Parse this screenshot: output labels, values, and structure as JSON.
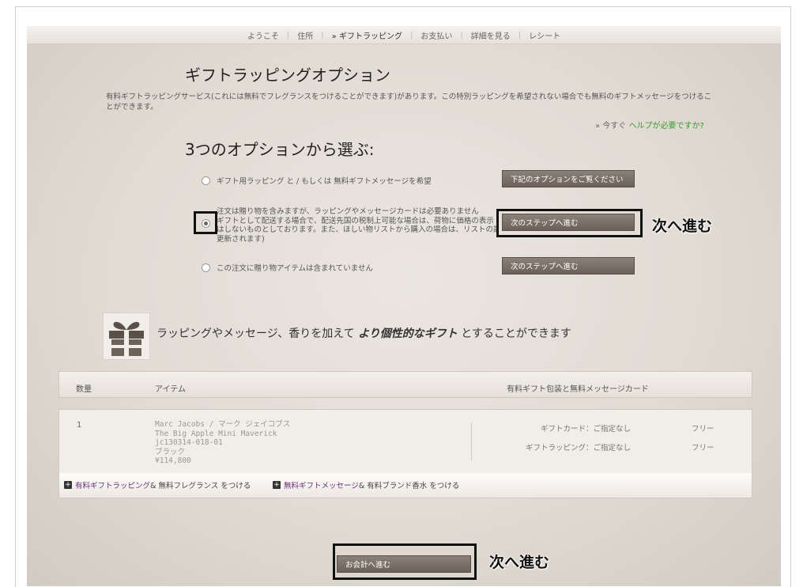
{
  "nav": {
    "items": [
      "ようこそ",
      "住所",
      "» ギフトラッピング",
      "お支払い",
      "詳細を見る",
      "レシート"
    ],
    "active_index": 2
  },
  "page": {
    "title": "ギフトラッピングオプション",
    "intro": "有料ギフトラッピングサービス(これには無料でフレグランスをつけることができます)があります。この特別ラッピングを希望されない場合でも無料のギフトメッセージをつけることができます。",
    "help_prefix": "» 今すぐ",
    "help_link": "ヘルプが必要ですか?",
    "choose_title": "3つのオプションから選ぶ:"
  },
  "options": [
    {
      "text": "ギフト用ラッピング と / もしくは 無料ギフトメッセージを希望",
      "button": "下記のオプションをご覧ください",
      "checked": false
    },
    {
      "text_lines": [
        "注文は贈り物を含みますが、ラッピングやメッセージカードは必要ありません",
        "ギフトとして配送する場合で、配送先国の税制上可能な場合は、荷物に価格の表示",
        "はしないものとしております。また、ほしい物リストから購入の場合は、リストの記録が",
        "更新されます)"
      ],
      "button": "次のステップへ進む",
      "checked": true
    },
    {
      "text": "この注文に贈り物アイテムは含まれていません",
      "button": "次のステップへ進む",
      "checked": false
    }
  ],
  "annotations": {
    "next1": "次へ進む",
    "next2": "次へ進む"
  },
  "tagline": {
    "before": "ラッピングやメッセージ、香りを加えて ",
    "emphasis": "より個性的なギフト",
    "after": " とすることができます"
  },
  "table": {
    "headers": [
      "数量",
      "アイテム",
      "有料ギフト包装と無料メッセージカード"
    ]
  },
  "item": {
    "qty": "1",
    "desc_lines": [
      "Marc Jacobs / マーク ジェイコブス",
      "The Big Apple Mini Maverick",
      "jc130314-018-01",
      "ブラック",
      "¥114,800"
    ],
    "gift_card_label": "ギフトカード：ご指定なし",
    "gift_card_value": "フリー",
    "gift_wrap_label": "ギフトラッピング：ご指定なし",
    "gift_wrap_value": "フリー",
    "extra1_link": "有料ギフトラッピング",
    "extra1_rest": " & 無料フレグランス をつける",
    "extra2_link": "無料ギフトメッセージ",
    "extra2_rest": " & 有料ブランド香水 をつける"
  },
  "checkout_button": "お会計へ進む",
  "icons": {
    "gift": "gift-box-icon",
    "plus": "plus-icon",
    "radio": "radio-icon"
  }
}
